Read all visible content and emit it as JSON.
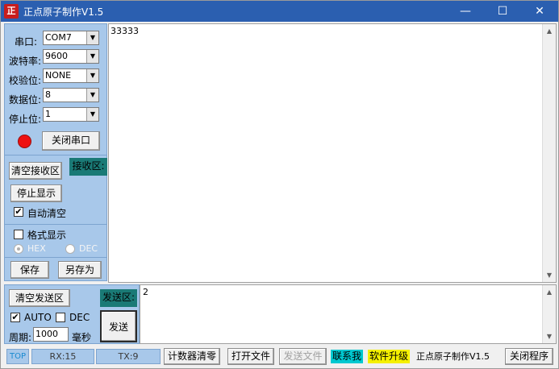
{
  "window": {
    "title": "正点原子制作V1.5",
    "app_icon_text": "正",
    "controls": {
      "minimize": "—",
      "maximize": "☐",
      "close": "✕"
    }
  },
  "serial": {
    "port_label": "串口:",
    "port_value": "COM7",
    "baud_label": "波特率:",
    "baud_value": "9600",
    "parity_label": "校验位:",
    "parity_value": "NONE",
    "databits_label": "数据位:",
    "databits_value": "8",
    "stopbits_label": "停止位:",
    "stopbits_value": "1",
    "status_color": "#ee1111",
    "close_port_label": "关闭串口"
  },
  "receive_controls": {
    "clear_label": "清空接收区",
    "area_tag": "接收区:",
    "stop_display_label": "停止显示",
    "auto_clear_label": "自动清空",
    "auto_clear_checked": true,
    "format_display_label": "格式显示",
    "format_display_checked": false,
    "hex_label": "HEX",
    "dec_label": "DEC",
    "save_label": "保存",
    "save_as_label": "另存为"
  },
  "receive_area": {
    "content": "33333"
  },
  "send_controls": {
    "clear_label": "清空发送区",
    "area_tag": "发送区:",
    "auto_label": "AUTO",
    "auto_checked": true,
    "dec_label": "DEC",
    "dec_checked": false,
    "period_label": "周期:",
    "period_value": "1000",
    "ms_label": "毫秒",
    "send_label": "发送"
  },
  "send_area": {
    "content": "2"
  },
  "status_bar": {
    "top_label": "TOP",
    "rx_text": "RX:15",
    "tx_text": "TX:9",
    "reset_counter_label": "计数器清零",
    "open_file_label": "打开文件",
    "send_file_label": "发送文件",
    "contact_label": "联系我",
    "upgrade_label": "软件升级",
    "author_label": "正点原子制作V1.5",
    "close_program_label": "关闭程序"
  },
  "colors": {
    "titlebar": "#2b5fb0",
    "panel": "#a8c8ea",
    "teal_tag": "#1a7a76",
    "contact_bg": "#00c8d0",
    "upgrade_bg": "#f5f000"
  }
}
